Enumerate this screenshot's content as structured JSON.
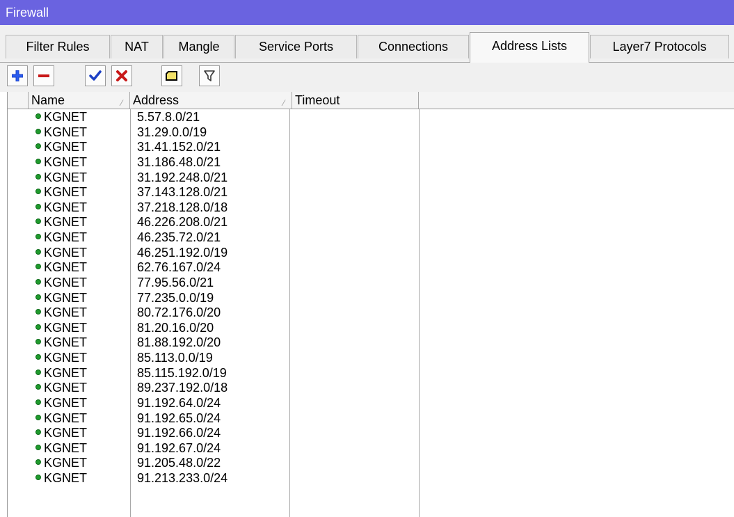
{
  "window": {
    "title": "Firewall"
  },
  "tabs": [
    {
      "label": "Filter Rules",
      "active": false
    },
    {
      "label": "NAT",
      "active": false
    },
    {
      "label": "Mangle",
      "active": false
    },
    {
      "label": "Service Ports",
      "active": false
    },
    {
      "label": "Connections",
      "active": false
    },
    {
      "label": "Address Lists",
      "active": true
    },
    {
      "label": "Layer7 Protocols",
      "active": false
    }
  ],
  "toolbar": {
    "buttons": [
      "add-icon",
      "remove-icon",
      "enable-icon",
      "disable-icon",
      "comment-icon",
      "filter-icon"
    ]
  },
  "columns": {
    "name": "Name",
    "address": "Address",
    "timeout": "Timeout"
  },
  "colors": {
    "titlebar": "#6a63e0",
    "status_dot": "#1f9a2d",
    "add": "#1b3fc4",
    "remove": "#c81818",
    "enable": "#1b3fc4",
    "disable": "#c81818",
    "comment": "#f4e26a"
  },
  "rows": [
    {
      "name": "KGNET",
      "address": "5.57.8.0/21",
      "timeout": ""
    },
    {
      "name": "KGNET",
      "address": "31.29.0.0/19",
      "timeout": ""
    },
    {
      "name": "KGNET",
      "address": "31.41.152.0/21",
      "timeout": ""
    },
    {
      "name": "KGNET",
      "address": "31.186.48.0/21",
      "timeout": ""
    },
    {
      "name": "KGNET",
      "address": "31.192.248.0/21",
      "timeout": ""
    },
    {
      "name": "KGNET",
      "address": "37.143.128.0/21",
      "timeout": ""
    },
    {
      "name": "KGNET",
      "address": "37.218.128.0/18",
      "timeout": ""
    },
    {
      "name": "KGNET",
      "address": "46.226.208.0/21",
      "timeout": ""
    },
    {
      "name": "KGNET",
      "address": "46.235.72.0/21",
      "timeout": ""
    },
    {
      "name": "KGNET",
      "address": "46.251.192.0/19",
      "timeout": ""
    },
    {
      "name": "KGNET",
      "address": "62.76.167.0/24",
      "timeout": ""
    },
    {
      "name": "KGNET",
      "address": "77.95.56.0/21",
      "timeout": ""
    },
    {
      "name": "KGNET",
      "address": "77.235.0.0/19",
      "timeout": ""
    },
    {
      "name": "KGNET",
      "address": "80.72.176.0/20",
      "timeout": ""
    },
    {
      "name": "KGNET",
      "address": "81.20.16.0/20",
      "timeout": ""
    },
    {
      "name": "KGNET",
      "address": "81.88.192.0/20",
      "timeout": ""
    },
    {
      "name": "KGNET",
      "address": "85.113.0.0/19",
      "timeout": ""
    },
    {
      "name": "KGNET",
      "address": "85.115.192.0/19",
      "timeout": ""
    },
    {
      "name": "KGNET",
      "address": "89.237.192.0/18",
      "timeout": ""
    },
    {
      "name": "KGNET",
      "address": "91.192.64.0/24",
      "timeout": ""
    },
    {
      "name": "KGNET",
      "address": "91.192.65.0/24",
      "timeout": ""
    },
    {
      "name": "KGNET",
      "address": "91.192.66.0/24",
      "timeout": ""
    },
    {
      "name": "KGNET",
      "address": "91.192.67.0/24",
      "timeout": ""
    },
    {
      "name": "KGNET",
      "address": "91.205.48.0/22",
      "timeout": ""
    },
    {
      "name": "KGNET",
      "address": "91.213.233.0/24",
      "timeout": ""
    }
  ]
}
